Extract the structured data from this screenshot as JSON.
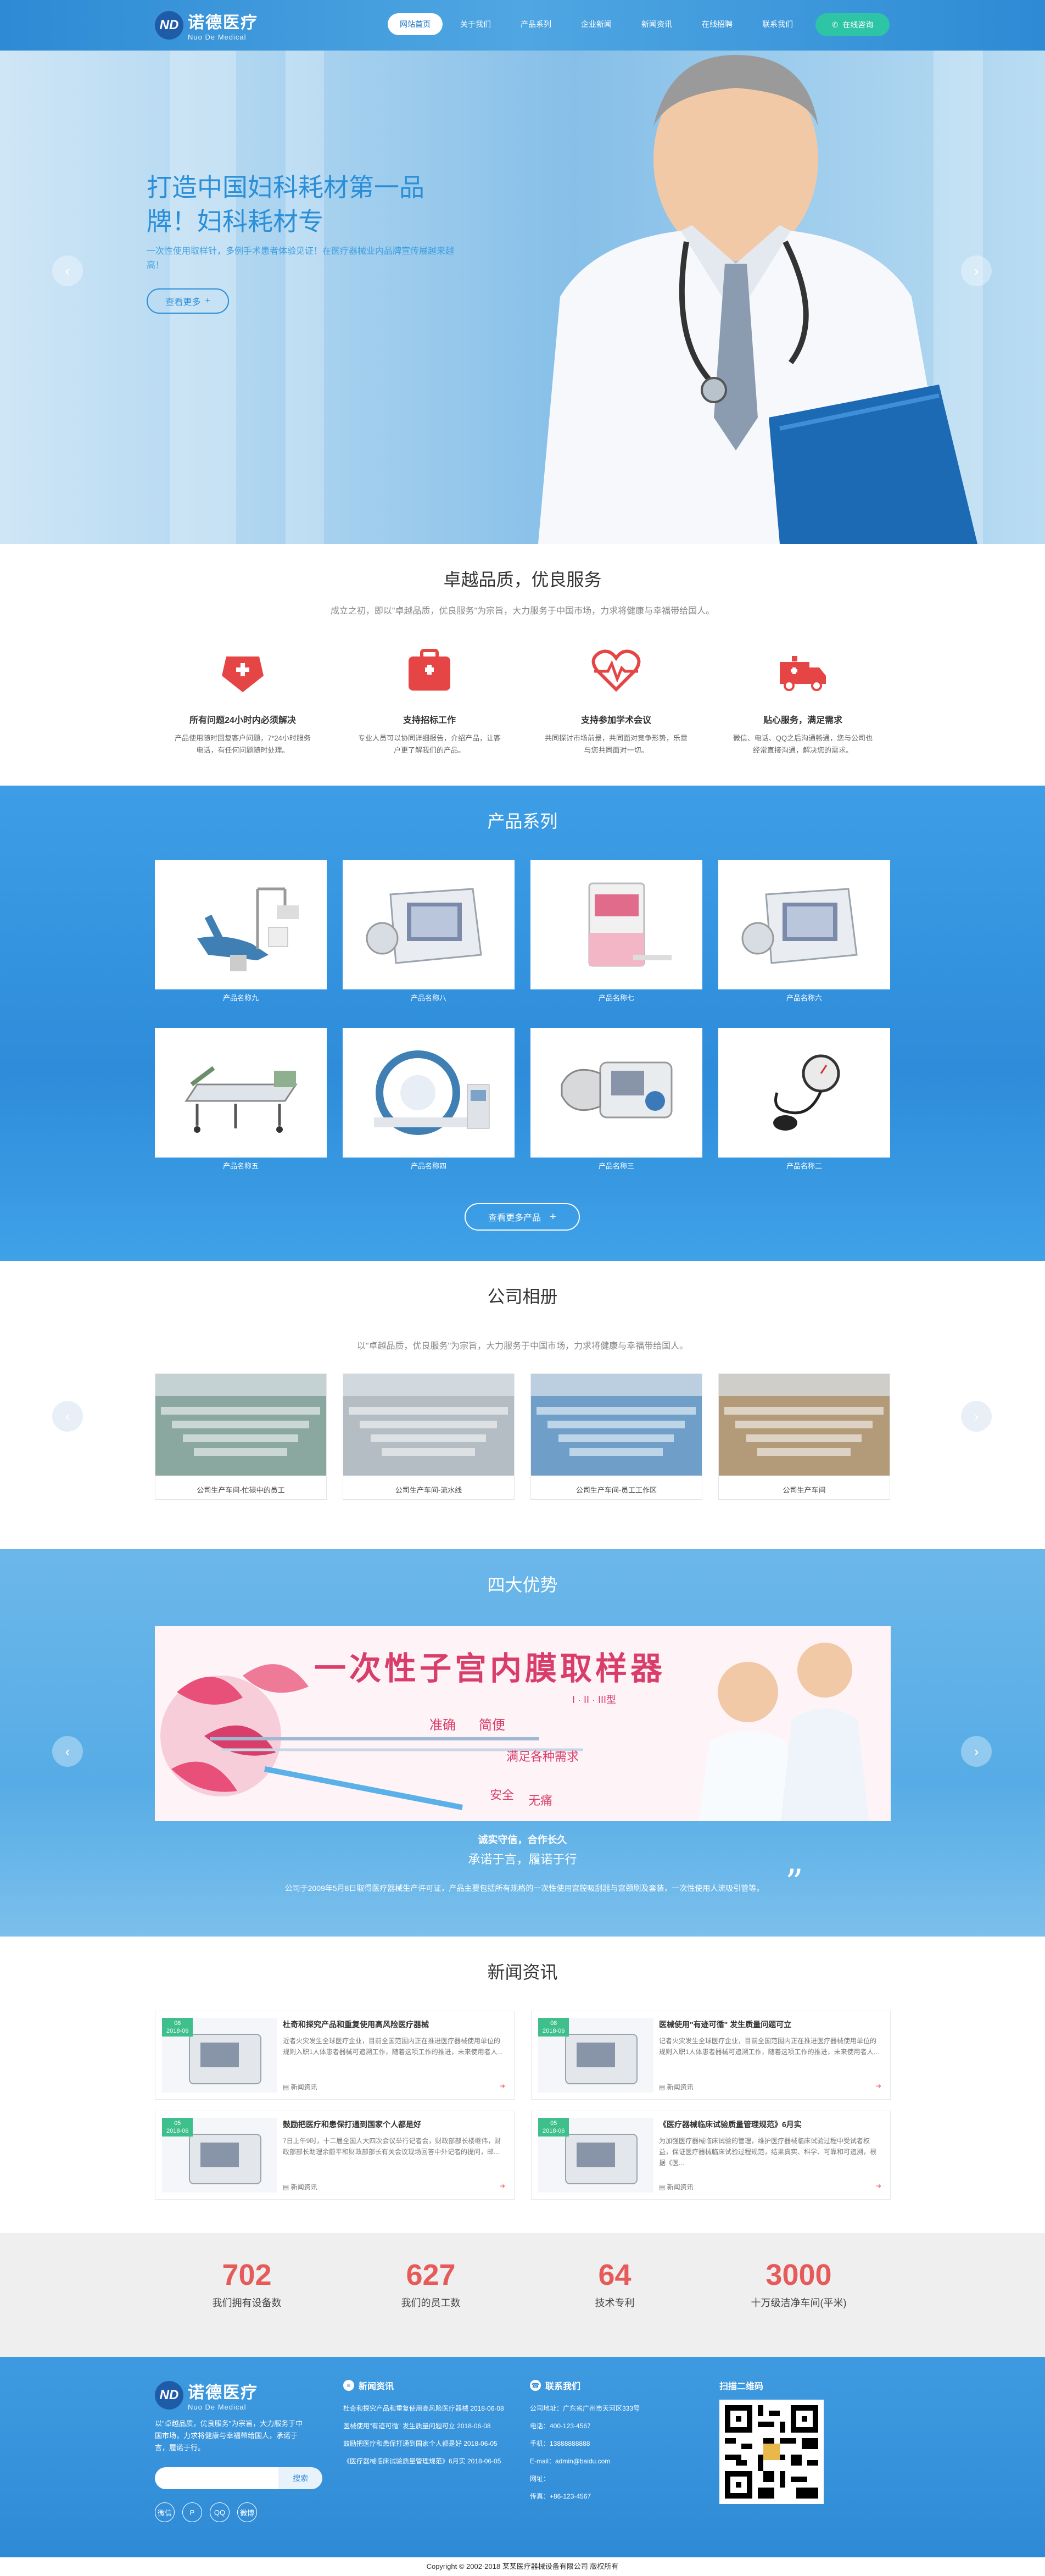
{
  "header": {
    "logo_mark": "ND",
    "logo_cn": "诺德医疗",
    "logo_en": "Nuo De Medical",
    "nav": [
      "网站首页",
      "关于我们",
      "产品系列",
      "企业新闻",
      "新闻资讯",
      "在线招聘",
      "联系我们"
    ],
    "online_label": "在线咨询"
  },
  "hero": {
    "title": "打造中国妇科耗材第一品牌！妇科耗材专",
    "desc": "一次性使用取样针，多例手术患者体验见证！在医疗器械业内品牌宣传展越来越高！",
    "more": "查看更多"
  },
  "service": {
    "title": "卓越品质，优良服务",
    "subtitle": "成立之初，即以\"卓越品质，优良服务\"为宗旨，大力服务于中国市场，力求将健康与幸福带给国人。",
    "items": [
      {
        "icon": "medical-kit-icon",
        "title": "所有问题24小时内必须解决",
        "desc": "产品使用随时回复客户问题，7*24小时服务电话，有任何问题随时处理。"
      },
      {
        "icon": "first-aid-icon",
        "title": "支持招标工作",
        "desc": "专业人员可以协同详细报告，介绍产品，让客户更了解我们的产品。"
      },
      {
        "icon": "heartbeat-icon",
        "title": "支持参加学术会议",
        "desc": "共同探讨市场前景，共同面对竞争形势，乐意与您共同面对一切。"
      },
      {
        "icon": "ambulance-icon",
        "title": "贴心服务，满足需求",
        "desc": "微信、电话、QQ之后沟通畅通，您与公司也经常直接沟通，解决您的需求。"
      }
    ]
  },
  "products": {
    "title": "产品系列",
    "items": [
      {
        "name": "产品名称九",
        "kind": "dental-chair"
      },
      {
        "name": "产品名称八",
        "kind": "monitor"
      },
      {
        "name": "产品名称七",
        "kind": "cabinet"
      },
      {
        "name": "产品名称六",
        "kind": "monitor"
      },
      {
        "name": "产品名称五",
        "kind": "bed"
      },
      {
        "name": "产品名称四",
        "kind": "scanner"
      },
      {
        "name": "产品名称三",
        "kind": "bp-monitor"
      },
      {
        "name": "产品名称二",
        "kind": "bp-cuff"
      }
    ],
    "more": "查看更多产品"
  },
  "album": {
    "title": "公司相册",
    "subtitle": "以\"卓越品质，优良服务\"为宗旨，大力服务于中国市场，力求将健康与幸福带给国人。",
    "items": [
      "公司生产车间-忙碌中的员工",
      "公司生产车间-流水线",
      "公司生产车间-员工工作区",
      "公司生产车间"
    ]
  },
  "advantage": {
    "title": "四大优势",
    "banner_title": "一次性子宫内膜取样器",
    "banner_tags": [
      "准确",
      "简便",
      "满足各种需求",
      "安全",
      "无痛",
      "I · II · III型"
    ],
    "slogan1": "诚实守信，合作长久",
    "slogan2": "承诺于言，履诺于行",
    "text": "公司于2009年5月8日取得医疗器械生产许可证，产品主要包括所有规格的一次性使用宫腔吸刮器与宫颈刷及套装，一次性使用人流吸引管等。"
  },
  "news": {
    "title": "新闻资讯",
    "detail_label": "新闻资讯",
    "items": [
      {
        "day": "08",
        "ym": "2018-06",
        "title": "杜奇和探究产品和重复使用高风险医疗器械",
        "desc": "近者火灾发生全球医疗企业，目前全国范围内正在推进医疗器械使用单位的规则入职1人体患者器械可追溯工作，随着这项工作的推进，未来使用者人..."
      },
      {
        "day": "08",
        "ym": "2018-06",
        "title": "医械使用\"有迹可循\" 发生质量问题可立",
        "desc": "记者火灾发生全球医疗企业，目前全国范围内正在推进医疗器械使用单位的规则入职1人体患者器械可追溯工作，随着这项工作的推进，未来使用者人..."
      },
      {
        "day": "05",
        "ym": "2018-06",
        "title": "鼓励把医疗和患保打通到国家个人都是好",
        "desc": "7日上午9时，十二届全国人大四次会议举行记者会，财政部部长楼继伟，财政部部长助理余蔚平和财政部部长有关会议现场回答中外记者的提问，邮..."
      },
      {
        "day": "05",
        "ym": "2018-06",
        "title": "《医疗器械临床试验质量管理规范》6月实",
        "desc": "为加强医疗器械临床试验的管理，维护医疗器械临床试验过程中受试者权益，保证医疗器械临床试验过程规范，结果真实、科学、可靠和可追溯，根据《医..."
      }
    ]
  },
  "stats": [
    {
      "num": "702",
      "label": "我们拥有设备数"
    },
    {
      "num": "627",
      "label": "我们的员工数"
    },
    {
      "num": "64",
      "label": "技术专利"
    },
    {
      "num": "3000",
      "label": "十万级洁净车间(平米)"
    }
  ],
  "footer": {
    "about": "以\"卓越品质，优良服务\"为宗旨，大力服务于中国市场，力求将健康与幸福带给国人，承诺于言，履诺于行。",
    "search_placeholder": "",
    "search_btn": "搜索",
    "social": [
      "微信",
      "P",
      "QQ",
      "微博"
    ],
    "news_head": "新闻资讯",
    "news_list": [
      "杜奇和探究产品和重复使用高风险医疗器械 2018-06-08",
      "医械使用\"有迹可循\" 发生质量问题可立 2018-06-08",
      "鼓励把医疗和患保打通到国家个人都是好 2018-06-05",
      "《医疗器械临床试验质量管理规范》6月实 2018-06-05"
    ],
    "contact_head": "联系我们",
    "contact_list": [
      "公司地址：广东省广州市天河区333号",
      "电话：400-123-4567",
      "手机：13888888888",
      "E-mail：admin@baidu.com",
      "网址：",
      "传真：+86-123-4567"
    ],
    "qr_head": "扫描二维码",
    "copyright": "Copyright © 2002-2018 某某医疗器械设备有限公司 版权所有"
  },
  "colors": {
    "primary": "#2e8cda",
    "accent": "#2ec4a6",
    "stat": "#e65a5a",
    "service_icon": "#e64545"
  }
}
